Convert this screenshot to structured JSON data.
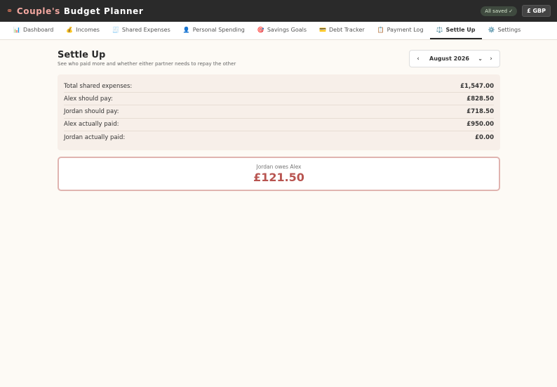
{
  "app": {
    "title_part1": "Couple's",
    "title_part2": "Budget Planner",
    "save_status": "All saved ✓",
    "currency": "£ GBP"
  },
  "tabs": [
    {
      "icon": "📊",
      "label": "Dashboard"
    },
    {
      "icon": "💰",
      "label": "Incomes"
    },
    {
      "icon": "🧾",
      "label": "Shared Expenses"
    },
    {
      "icon": "👤",
      "label": "Personal Spending"
    },
    {
      "icon": "🎯",
      "label": "Savings Goals"
    },
    {
      "icon": "💳",
      "label": "Debt Tracker"
    },
    {
      "icon": "📋",
      "label": "Payment Log"
    },
    {
      "icon": "⚖️",
      "label": "Settle Up"
    },
    {
      "icon": "⚙️",
      "label": "Settings"
    }
  ],
  "active_tab": "Settle Up",
  "page": {
    "title": "Settle Up",
    "subtitle": "See who paid more and whether either partner needs to repay the other"
  },
  "month_nav": {
    "prev": "‹",
    "selected": "August 2026",
    "next": "›"
  },
  "summary": [
    {
      "label": "Total shared expenses:",
      "value": "£1,547.00"
    },
    {
      "label": "Alex should pay:",
      "value": "£828.50"
    },
    {
      "label": "Jordan should pay:",
      "value": "£718.50"
    },
    {
      "label": "Alex actually paid:",
      "value": "£950.00"
    },
    {
      "label": "Jordan actually paid:",
      "value": "£0.00"
    }
  ],
  "result": {
    "text": "Jordan owes Alex",
    "amount": "£121.50"
  },
  "colors": {
    "header_bg": "#2a2a2a",
    "accent": "#b85450",
    "card_bg": "#f7efe9"
  }
}
